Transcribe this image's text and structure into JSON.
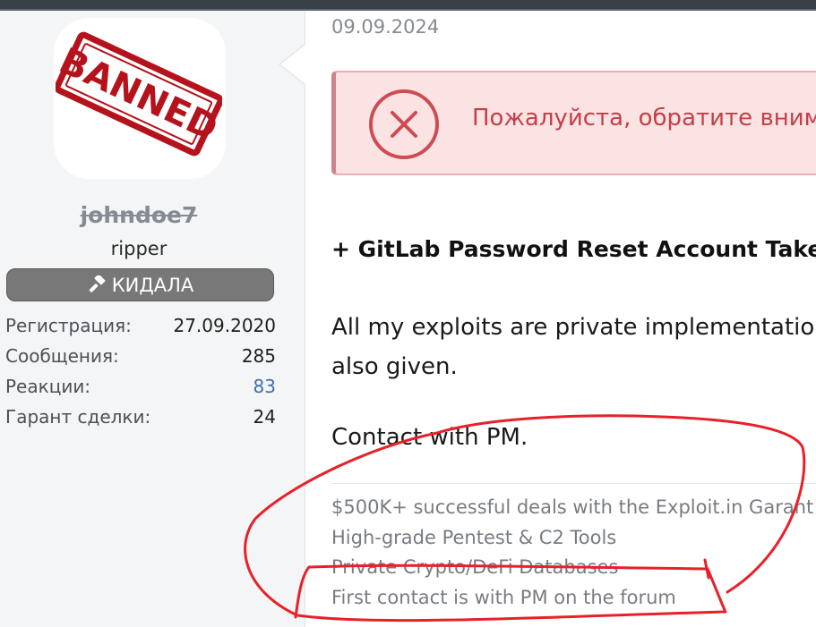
{
  "user": {
    "avatar_stamp_text": "BANNED",
    "username": "johndoe7",
    "title": "ripper",
    "banner_label": "КИДАЛА",
    "banner_icon": "gavel-icon",
    "stats": [
      {
        "label": "Регистрация:",
        "value": "27.09.2020",
        "link": false
      },
      {
        "label": "Сообщения:",
        "value": "285",
        "link": false
      },
      {
        "label": "Реакции:",
        "value": "83",
        "link": true
      },
      {
        "label": "Гарант сделки:",
        "value": "24",
        "link": false
      }
    ]
  },
  "post": {
    "date": "09.09.2024",
    "alert": {
      "icon": "close-circle-icon",
      "text": "Пожалуйста, обратите вним"
    },
    "heading": "+ GitLab Password Reset Account Take",
    "paragraph": "All my exploits are private implementatio also given.",
    "contact": "Contact with PM.",
    "signature": [
      "$500K+ successful deals with the Exploit.in Garant",
      "High-grade Pentest & C2 Tools",
      "Private Crypto/DeFi Databases",
      "First contact is with PM on the forum"
    ]
  },
  "colors": {
    "stamp_red": "#b5121b",
    "annotation_red": "#e8202a",
    "alert_text": "#c43f47",
    "link_blue": "#3a6eb3"
  }
}
